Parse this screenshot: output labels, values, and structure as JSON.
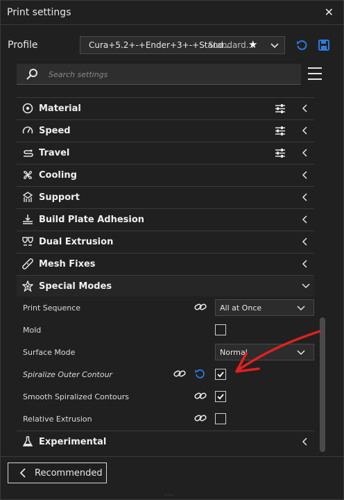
{
  "window": {
    "title": "Print settings",
    "close_glyph": "✕"
  },
  "profile": {
    "label": "Profile",
    "name": "Cura+5.2+-+Ender+3+-+Stand...",
    "quality": "- Standard...",
    "favorite_icon": "star-icon"
  },
  "search": {
    "placeholder": "Search settings"
  },
  "categories": [
    {
      "label": "Material",
      "icon": "material-icon",
      "has_tune": true,
      "expanded": false
    },
    {
      "label": "Speed",
      "icon": "speed-icon",
      "has_tune": true,
      "expanded": false
    },
    {
      "label": "Travel",
      "icon": "travel-icon",
      "has_tune": true,
      "expanded": false
    },
    {
      "label": "Cooling",
      "icon": "cooling-fan-icon",
      "has_tune": false,
      "expanded": false
    },
    {
      "label": "Support",
      "icon": "support-icon",
      "has_tune": false,
      "expanded": false
    },
    {
      "label": "Build Plate Adhesion",
      "icon": "adhesion-icon",
      "has_tune": false,
      "expanded": false
    },
    {
      "label": "Dual Extrusion",
      "icon": "dual-extrusion-icon",
      "has_tune": false,
      "expanded": false
    },
    {
      "label": "Mesh Fixes",
      "icon": "mesh-fixes-icon",
      "has_tune": false,
      "expanded": false
    },
    {
      "label": "Special Modes",
      "icon": "special-modes-icon",
      "has_tune": false,
      "expanded": true
    },
    {
      "label": "Experimental",
      "icon": "experimental-flask-icon",
      "has_tune": false,
      "expanded": false
    }
  ],
  "special_modes": {
    "print_sequence": {
      "label": "Print Sequence",
      "value": "All at Once"
    },
    "mold": {
      "label": "Mold",
      "checked": false
    },
    "surface_mode": {
      "label": "Surface Mode",
      "value": "Normal"
    },
    "spiralize": {
      "label": "Spiralize Outer Contour",
      "checked": true
    },
    "smooth_spiralized": {
      "label": "Smooth Spiralized Contours",
      "checked": true
    },
    "relative_extrusion": {
      "label": "Relative Extrusion",
      "checked": false
    }
  },
  "footer": {
    "recommended_label": "Recommended"
  },
  "colors": {
    "accent": "#2c7be5",
    "annotation": "#e02020",
    "background": "#1f1f1f"
  }
}
